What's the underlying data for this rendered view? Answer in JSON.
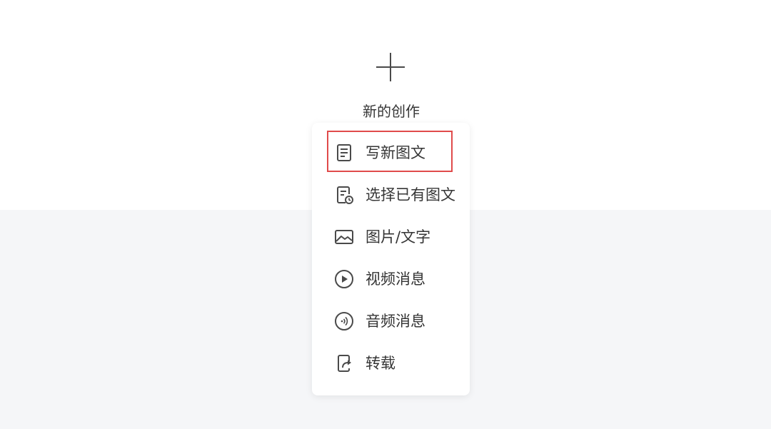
{
  "create": {
    "label": "新的创作"
  },
  "menu": {
    "items": [
      {
        "label": "写新图文",
        "icon": "document-icon"
      },
      {
        "label": "选择已有图文",
        "icon": "document-clock-icon"
      },
      {
        "label": "图片/文字",
        "icon": "image-icon"
      },
      {
        "label": "视频消息",
        "icon": "play-circle-icon"
      },
      {
        "label": "音频消息",
        "icon": "audio-circle-icon"
      },
      {
        "label": "转载",
        "icon": "repost-icon"
      }
    ]
  },
  "colors": {
    "highlight": "#e04b4b",
    "bottom_background": "#f5f6f8",
    "text": "#353535"
  }
}
